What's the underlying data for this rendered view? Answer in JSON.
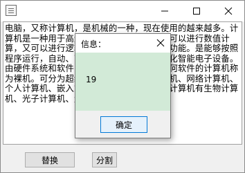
{
  "main": {
    "text": "电脑，又称计算机，是机械的一种，现在使用的越来越多。计算机是一种用于高速计算的电子计算机器，可以进行数值计算，又可以进行逻辑计算，还具有存储记忆功能。是能够按照程序运行，自动、高速处理海量数据的现代化智能电子设备。由硬件系统和软件系统所组成，没有安装任何软件的计算机称为裸机。可分为超级计算机、工业控制计算机、网络计算机、个人计算机、嵌入式计算机五类，较先进的计算机有生物计算机、光子计算机、量子计算机等。",
    "replace_label": "替换",
    "split_label": "分割"
  },
  "dialog": {
    "title": "信息：",
    "value": "19",
    "ok_label": "确定"
  }
}
